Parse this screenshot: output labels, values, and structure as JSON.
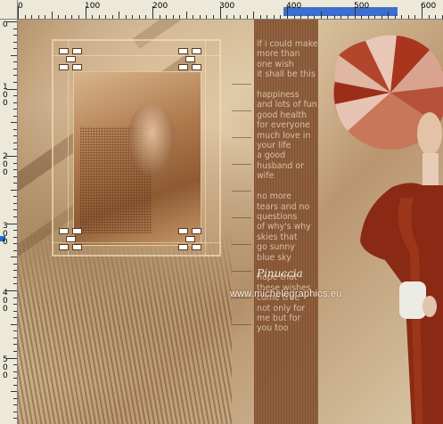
{
  "ruler": {
    "horizontal_labels": [
      "0",
      "100",
      "200",
      "300",
      "400",
      "500",
      "600"
    ],
    "vertical_labels": [
      "0",
      "100",
      "200",
      "300",
      "400",
      "500"
    ]
  },
  "canvas": {
    "poem": "if i could make\nmore than\none wish\nit shall be this\n\nhappiness\nand lots of fun\ngood health\nfor everyone\nmuch love in\nyour life\na good\nhusband or\nwife\n\nno more\ntears and no\nquestions\nof why's why\nskies that\ngo sunny\nblue sky\n\nhope that\nthese wishes\ncome true\nnot only for\nme but for\nyou too",
    "watermark_name": "Pinuccia",
    "watermark_url": "www.michelegraphics.eu"
  },
  "colors": {
    "ruler_background": "#ece9d8",
    "ruler_selection": "#3b6ecf",
    "text_strip": "#8b5a38",
    "dress": "#8a2a14"
  }
}
